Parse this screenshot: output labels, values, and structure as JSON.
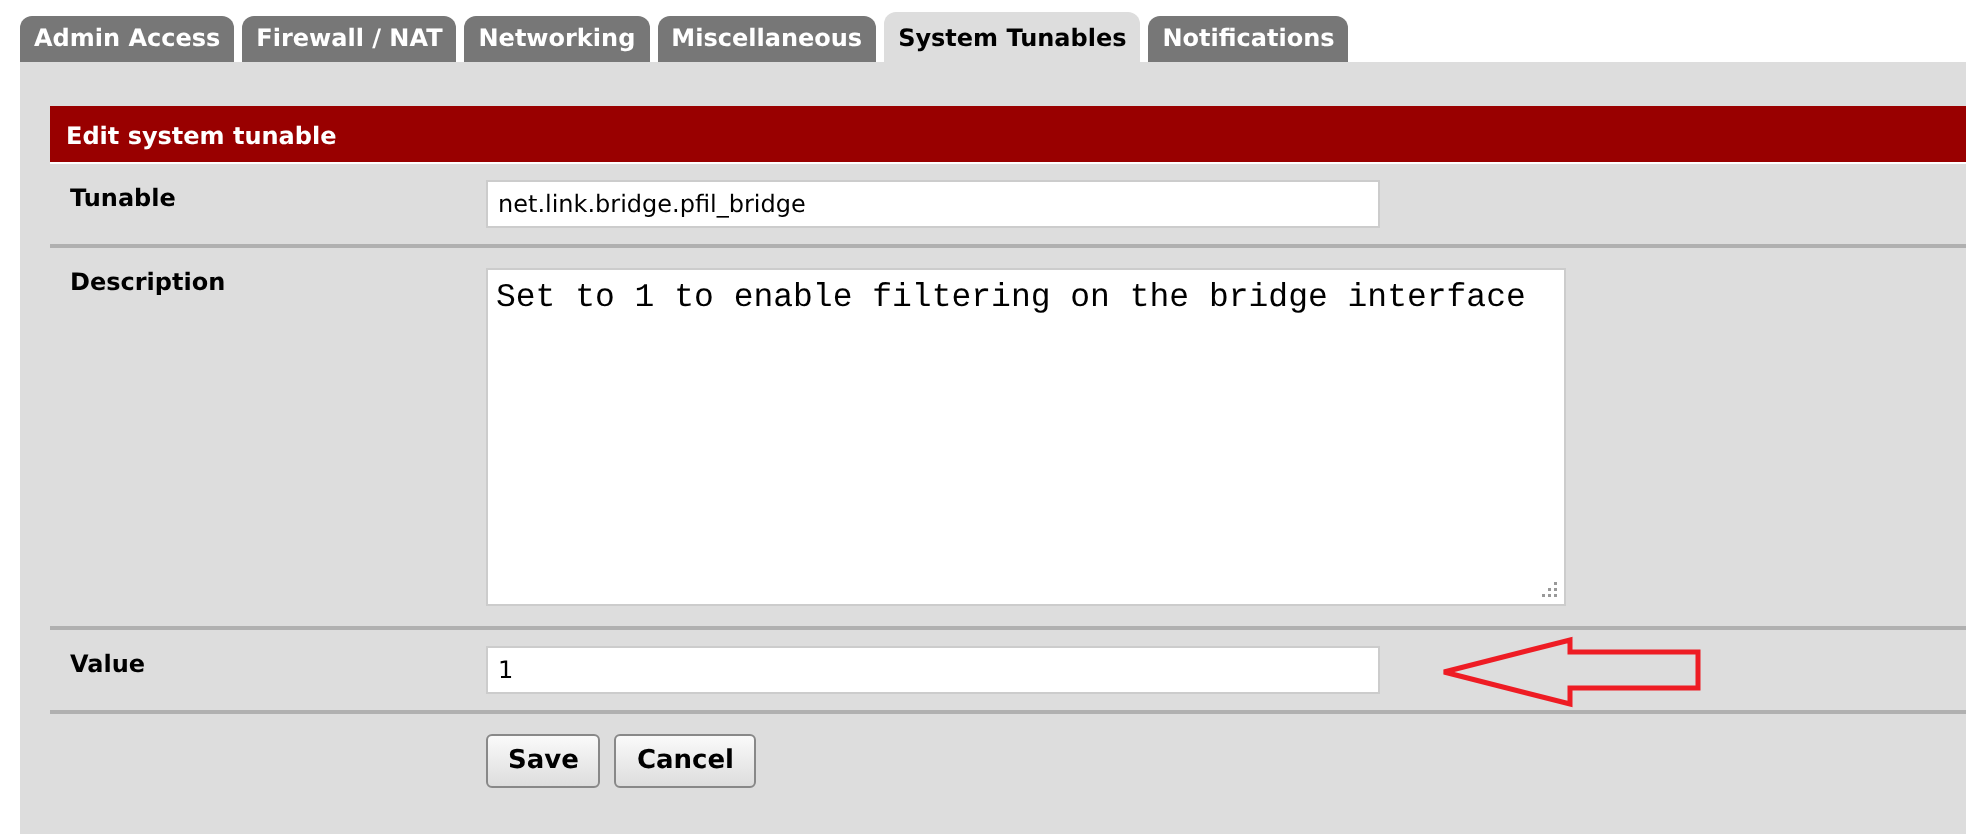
{
  "tabs": [
    {
      "label": "Admin Access",
      "selected": false
    },
    {
      "label": "Firewall / NAT",
      "selected": false
    },
    {
      "label": "Networking",
      "selected": false
    },
    {
      "label": "Miscellaneous",
      "selected": false
    },
    {
      "label": "System Tunables",
      "selected": true
    },
    {
      "label": "Notifications",
      "selected": false
    }
  ],
  "section": {
    "title": "Edit system tunable",
    "fields": [
      {
        "kind": "input",
        "label": "Tunable",
        "value": "net.link.bridge.pfil_bridge"
      },
      {
        "kind": "textarea",
        "label": "Description",
        "value": "Set to 1 to enable filtering on the bridge interface"
      },
      {
        "kind": "input",
        "label": "Value",
        "value": "1"
      }
    ],
    "buttons": [
      "Save",
      "Cancel"
    ]
  }
}
